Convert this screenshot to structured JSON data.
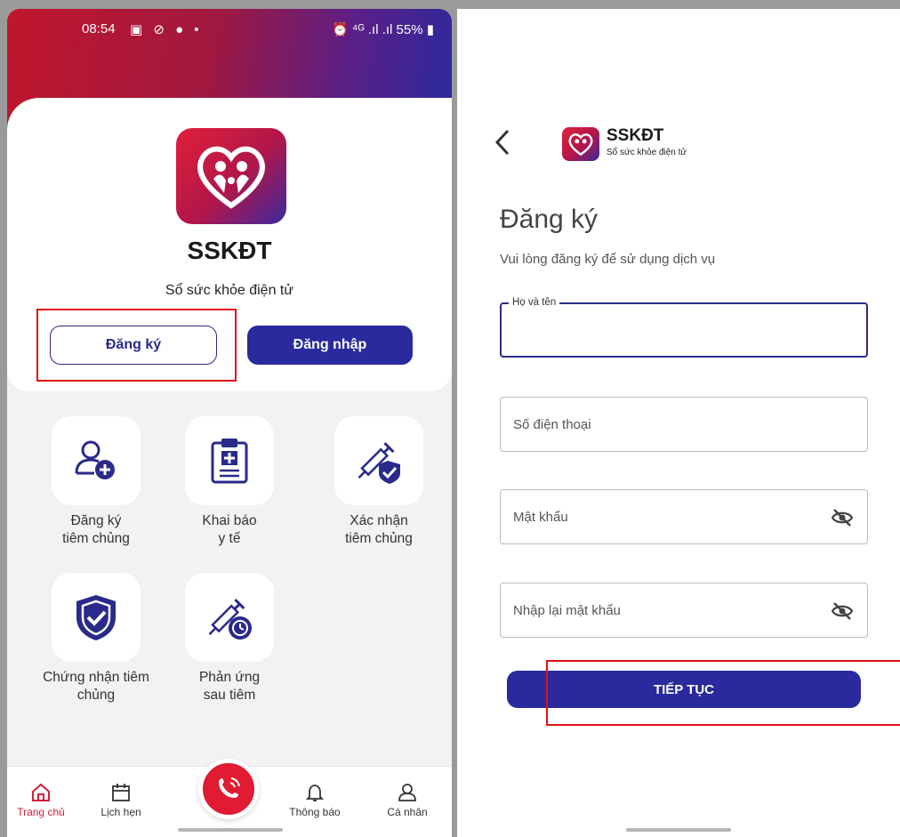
{
  "left": {
    "status": {
      "time": "08:54",
      "icons_left": "▣ ⊘ ● •",
      "right": "⏰ ⁴ᴳ .ıl .ıl 55% ▮"
    },
    "app_name": "SSKĐT",
    "app_subtitle": "Sổ sức khỏe điện tử",
    "register_label": "Đăng ký",
    "login_label": "Đăng nhập",
    "tiles": [
      {
        "label": "Đăng ký\ntiêm chủng",
        "icon": "add-user-icon"
      },
      {
        "label": "Khai báo\ny tế",
        "icon": "medical-clipboard-icon"
      },
      {
        "label": "Xác nhận\ntiêm chủng",
        "icon": "vaccine-shield-icon"
      },
      {
        "label": "Chứng nhận tiêm\nchủng",
        "icon": "shield-check-icon"
      },
      {
        "label": "Phản ứng\nsau tiêm",
        "icon": "vaccine-clock-icon"
      }
    ],
    "nav": [
      {
        "label": "Trang chủ",
        "icon": "home-icon"
      },
      {
        "label": "Lịch hẹn",
        "icon": "calendar-icon"
      },
      {
        "label": "Thông báo",
        "icon": "bell-icon"
      },
      {
        "label": "Cá nhân",
        "icon": "user-icon"
      }
    ]
  },
  "right": {
    "app_name": "SSKĐT",
    "app_subtitle": "Sổ sức khỏe điện tử",
    "title": "Đăng ký",
    "subtitle": "Vui lòng đăng ký để sử dụng dịch vụ",
    "fields": {
      "fullname_legend": "Họ và tên",
      "phone_placeholder": "Số điện thoại",
      "password_placeholder": "Mật khẩu",
      "confirm_placeholder": "Nhập lại mật khẩu"
    },
    "continue_label": "TIẾP TỤC"
  },
  "colors": {
    "primary": "#2a2a9e",
    "accent_red": "#e01b32",
    "highlight": "#e01010"
  }
}
